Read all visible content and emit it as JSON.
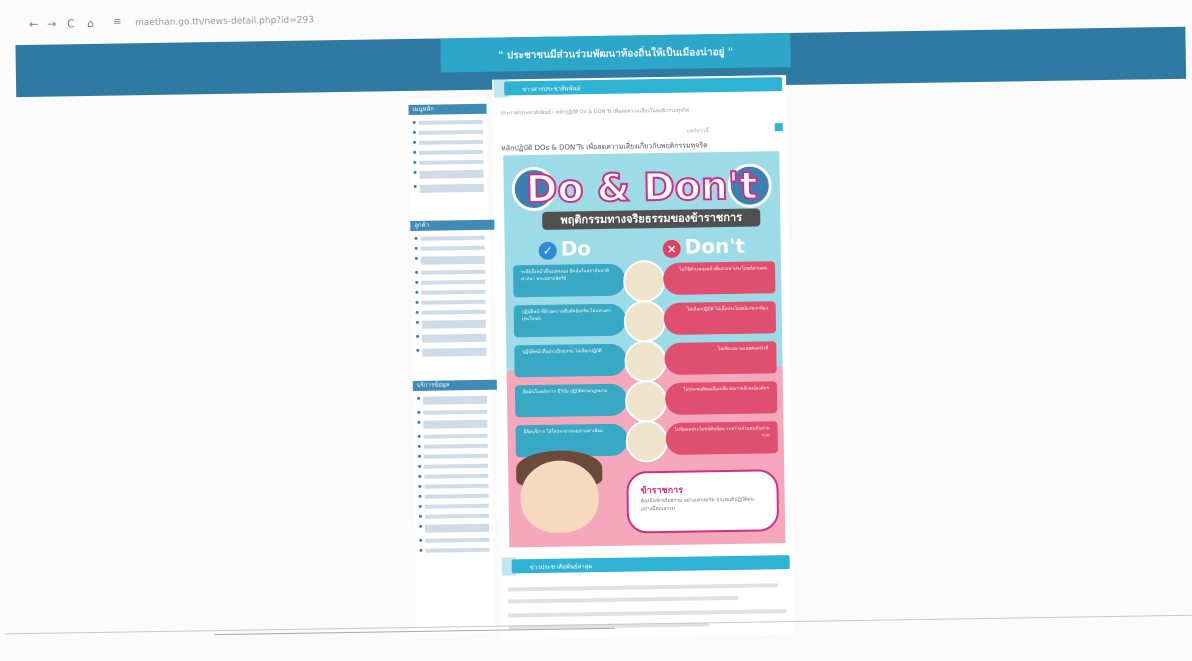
{
  "browser": {
    "back_icon": "←",
    "forward_icon": "→",
    "reload_icon": "C",
    "home_icon": "⌂",
    "site_icon": "≡",
    "url": "maethan.go.th/news-detail.php?id=293",
    "zoom_icon": "🔍",
    "star_icon": "☆",
    "menu_icon": "⋮"
  },
  "header": {
    "banner_text": "\" ประชาชนมีส่วนร่วมพัฒนาท้องถิ่นให้เป็นเมืองน่าอยู่ \""
  },
  "sidebar": {
    "section1": "เมนูหลัก",
    "section2": "ลูกค้า",
    "section3": "บริการข้อมูล"
  },
  "main": {
    "tab_label": "ข่าวสารประชาสัมพันธ์",
    "breadcrumb": "ประกาศ/ประชาสัมพันธ์ › หลักปฏิบัติ Do & DON'Ts เพื่อลดความเสี่ยงในพฤติกรรมทุจริต",
    "share_text": "แชร์ข่าวนี้",
    "post_title": "หลักปฏิบัติ DOs & DON'Ts เพื่อลดความเสี่ยงเกี่ยวกับพฤติกรรมทุจริต",
    "section2_label": "ข่าวประชาสัมพันธ์ล่าสุด"
  },
  "poster": {
    "title": "Do & Don't",
    "subtitle": "พฤติกรรมทางจริยธรรมของข้าราชการ",
    "do_label": "Do",
    "dont_label": "Don't",
    "do_mark": "✓",
    "dont_mark": "×",
    "do_rows": [
      "ระลึกถึงหน้าที่ของตนเอง ยึดมั่นในสถาบันชาติ ศาสนา พระมหากษัตริย์",
      "ปฏิบัติหน้าที่ด้วยความซื่อสัตย์สุจริต ไม่แสวงหาประโยชน์",
      "ปฏิบัติหน้าที่อย่างเป็นธรรม ไม่เลือกปฏิบัติ",
      "ยึดมั่นในหลักการ มีวินัย ปฏิบัติตามกฎหมาย",
      "มีจิตบริการ ใส่ใจประชาชนอย่างเท่าเทียม"
    ],
    "dont_rows": [
      "ไม่ใช้ตำแหน่งหน้าที่แสวงหาประโยชน์ส่วนตน",
      "ไม่เลือกปฏิบัติ ไม่เอื้อประโยชน์แก่พวกพ้อง",
      "ไม่เพิกเฉย ละเลยต่อหน้าที่",
      "ไม่ประพฤติตนเสื่อมเสีย ต่อภาพลักษณ์องค์กร",
      "ไม่ขัดผลประโยชน์ทับซ้อน ระหว่างส่วนตนกับส่วนรวม"
    ],
    "bubble_title": "ข้าราชการ",
    "bubble_text": "ต้องมีหลักจริยธรรม อย่างเคร่งครัด ประพฤติปฏิบัติตนอย่างมีคุณธรรม"
  }
}
